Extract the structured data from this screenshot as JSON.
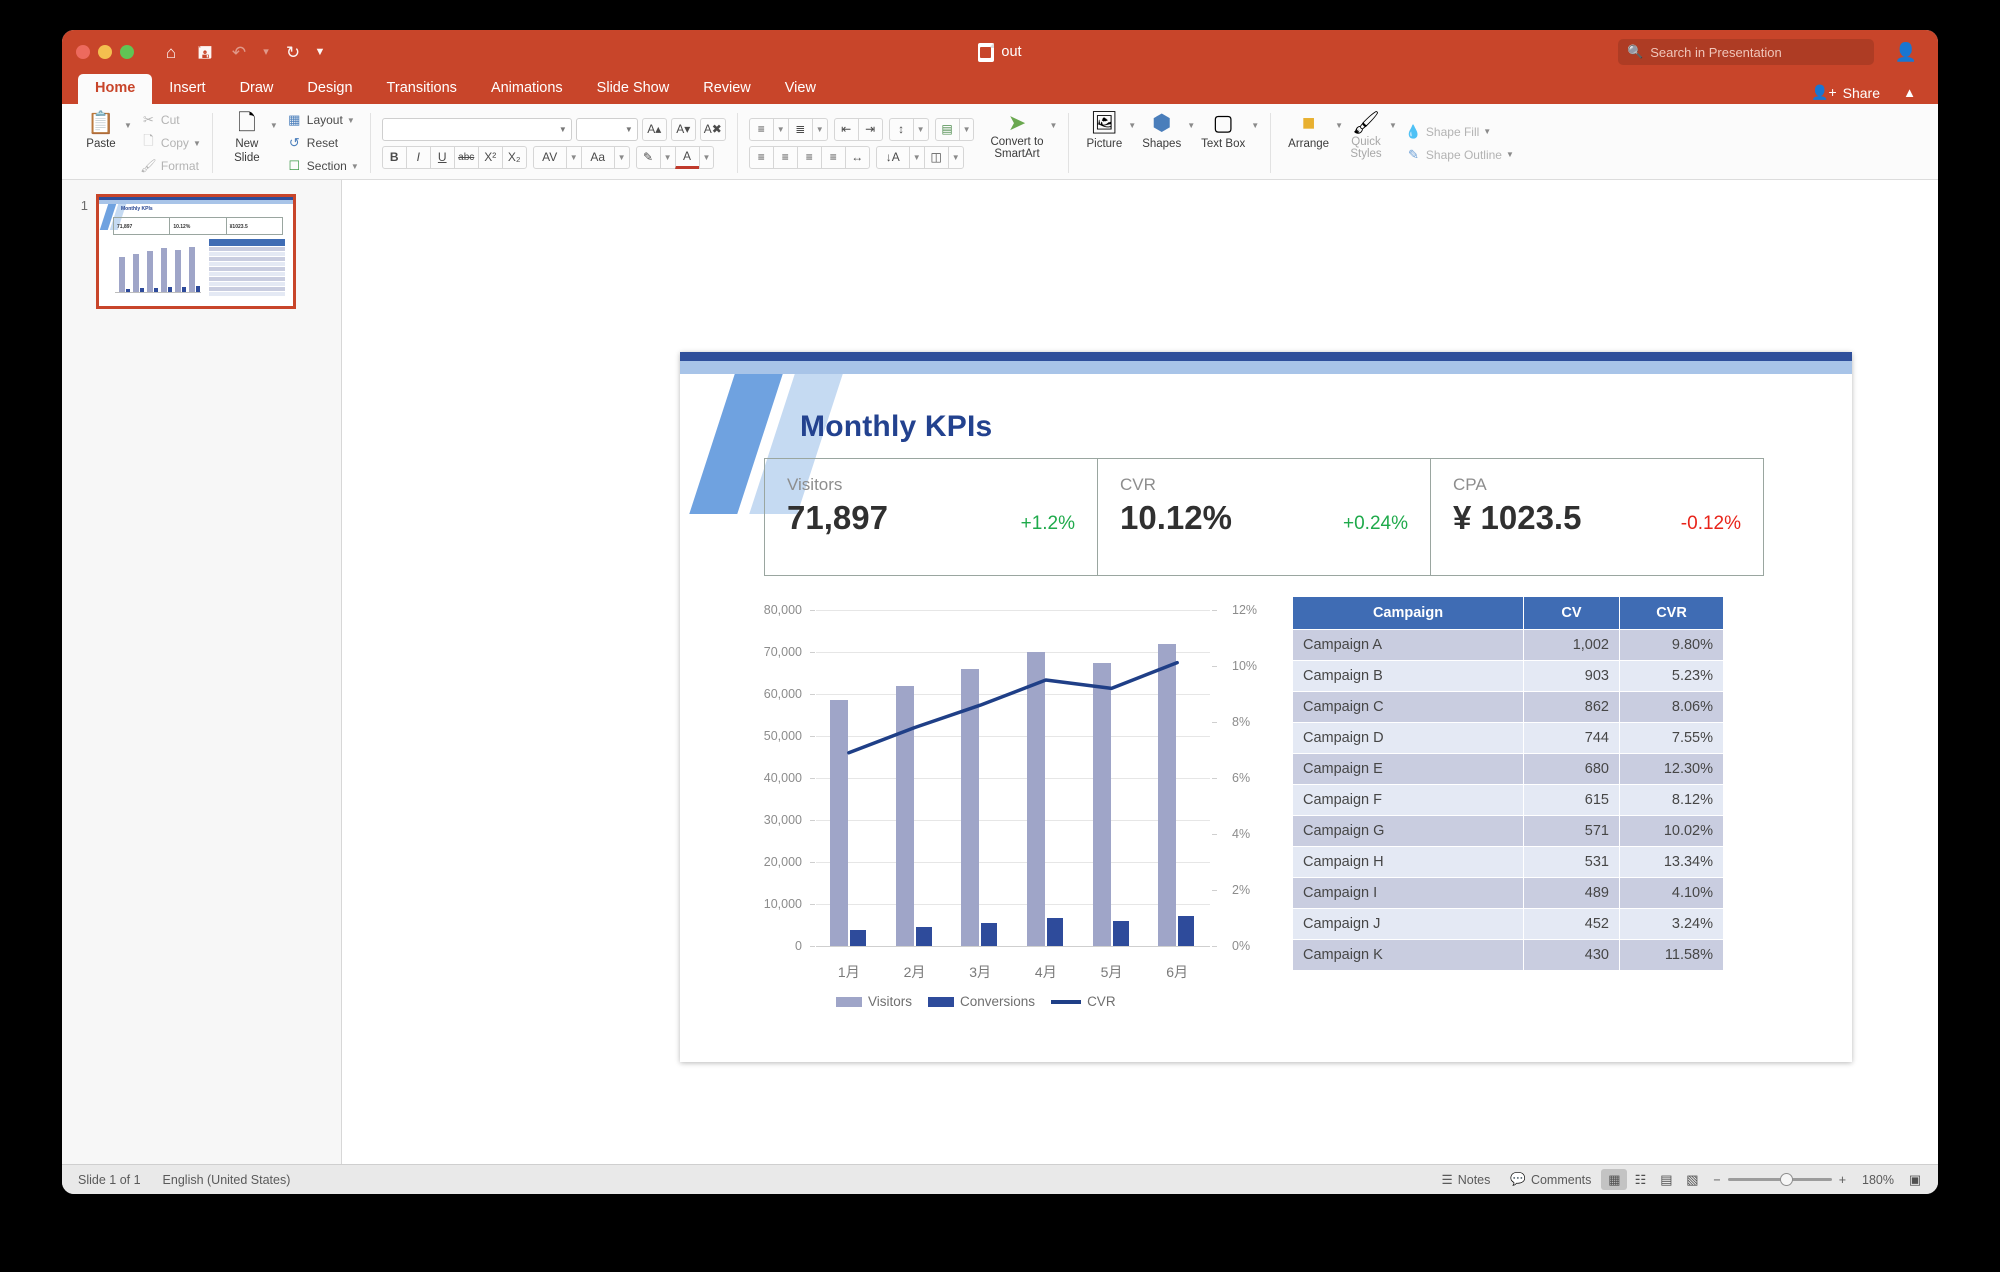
{
  "window": {
    "doc_title": "out",
    "search_placeholder": "Search in Presentation",
    "share_label": "Share"
  },
  "quick_access": [
    {
      "name": "home-icon",
      "glyph": "⌂"
    },
    {
      "name": "save-icon",
      "glyph": "὚B"
    },
    {
      "name": "undo-icon",
      "glyph": "↶"
    },
    {
      "name": "redo-icon",
      "glyph": "↻"
    },
    {
      "name": "customize-toolbar-icon",
      "glyph": "☰"
    }
  ],
  "tabs": [
    {
      "label": "Home",
      "active": true
    },
    {
      "label": "Insert",
      "active": false
    },
    {
      "label": "Draw",
      "active": false
    },
    {
      "label": "Design",
      "active": false
    },
    {
      "label": "Transitions",
      "active": false
    },
    {
      "label": "Animations",
      "active": false
    },
    {
      "label": "Slide Show",
      "active": false
    },
    {
      "label": "Review",
      "active": false
    },
    {
      "label": "View",
      "active": false
    }
  ],
  "ribbon": {
    "paste": "Paste",
    "cut": "Cut",
    "copy": "Copy",
    "format": "Format",
    "new_slide": "New\nSlide",
    "new_slide_line1": "New",
    "new_slide_line2": "Slide",
    "layout": "Layout",
    "reset": "Reset",
    "section": "Section",
    "font_name": "",
    "font_size": "",
    "convert_to_smartart_line1": "Convert to",
    "convert_to_smartart_line2": "SmartArt",
    "picture": "Picture",
    "shapes": "Shapes",
    "text_box": "Text Box",
    "arrange": "Arrange",
    "quick_styles_line1": "Quick",
    "quick_styles_line2": "Styles",
    "shape_fill": "Shape Fill",
    "shape_outline": "Shape Outline"
  },
  "thumbnail": {
    "number": "1",
    "title": "Monthly KPIs"
  },
  "slide": {
    "title": "Monthly KPIs",
    "kpis": [
      {
        "label": "Visitors",
        "value": "71,897",
        "delta": "+1.2%",
        "direction": "up"
      },
      {
        "label": "CVR",
        "value": "10.12%",
        "delta": "+0.24%",
        "direction": "up"
      },
      {
        "label": "CPA",
        "value": "¥ 1023.5",
        "delta": "-0.12%",
        "direction": "down"
      }
    ],
    "table": {
      "headers": [
        "Campaign",
        "CV",
        "CVR"
      ],
      "rows": [
        [
          "Campaign A",
          "1,002",
          "9.80%"
        ],
        [
          "Campaign B",
          "903",
          "5.23%"
        ],
        [
          "Campaign C",
          "862",
          "8.06%"
        ],
        [
          "Campaign D",
          "744",
          "7.55%"
        ],
        [
          "Campaign E",
          "680",
          "12.30%"
        ],
        [
          "Campaign F",
          "615",
          "8.12%"
        ],
        [
          "Campaign G",
          "571",
          "10.02%"
        ],
        [
          "Campaign H",
          "531",
          "13.34%"
        ],
        [
          "Campaign I",
          "489",
          "4.10%"
        ],
        [
          "Campaign J",
          "452",
          "3.24%"
        ],
        [
          "Campaign K",
          "430",
          "11.58%"
        ]
      ]
    }
  },
  "chart_data": {
    "type": "bar",
    "title": "",
    "categories": [
      "1月",
      "2月",
      "3月",
      "4月",
      "5月",
      "6月"
    ],
    "series": [
      {
        "name": "Visitors",
        "type": "bar",
        "axis": "left",
        "color": "#9fa5c8",
        "values": [
          58500,
          62000,
          66000,
          70000,
          67500,
          71897
        ]
      },
      {
        "name": "Conversions",
        "type": "bar",
        "axis": "left",
        "color": "#2e4b9b",
        "values": [
          3900,
          4600,
          5400,
          6600,
          6000,
          7200
        ]
      },
      {
        "name": "CVR",
        "type": "line",
        "axis": "right",
        "color": "#1f3f87",
        "values": [
          6.9,
          7.8,
          8.6,
          9.5,
          9.2,
          10.12
        ]
      }
    ],
    "ylabel": "",
    "xlabel": "",
    "ylim": [
      0,
      80000
    ],
    "y_ticks": [
      "0",
      "10,000",
      "20,000",
      "30,000",
      "40,000",
      "50,000",
      "60,000",
      "70,000",
      "80,000"
    ],
    "y2lim": [
      0,
      12
    ],
    "y2_ticks": [
      "0%",
      "2%",
      "4%",
      "6%",
      "8%",
      "10%",
      "12%"
    ],
    "grid": true,
    "legend_position": "bottom",
    "legend": [
      "Visitors",
      "Conversions",
      "CVR"
    ]
  },
  "statusbar": {
    "slide_count": "Slide 1 of 1",
    "language": "English (United States)",
    "notes": "Notes",
    "comments": "Comments",
    "zoom_level": "180%"
  },
  "colors": {
    "accent_red": "#c8452a",
    "title_blue": "#23428f",
    "table_header": "#3f6cb4",
    "up_green": "#1faa4b",
    "down_red": "#e8241a"
  }
}
